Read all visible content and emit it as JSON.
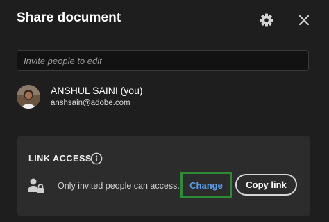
{
  "dialog": {
    "title": "Share document"
  },
  "invite": {
    "placeholder": "Invite people to edit",
    "value": ""
  },
  "user": {
    "name": "ANSHUL SAINI (you)",
    "email": "anshsain@adobe.com"
  },
  "link_access": {
    "label": "LINK ACCESS",
    "status": "Only invited people can access.",
    "change_label": "Change",
    "copy_label": "Copy link"
  },
  "icons": {
    "settings": "gear-icon",
    "close": "close-icon",
    "info": "info-icon",
    "access": "lock-person-icon"
  },
  "colors": {
    "background": "#1e1e1e",
    "panel": "#2c2c2c",
    "link": "#5b9ff0",
    "highlight": "#2e8b36"
  }
}
